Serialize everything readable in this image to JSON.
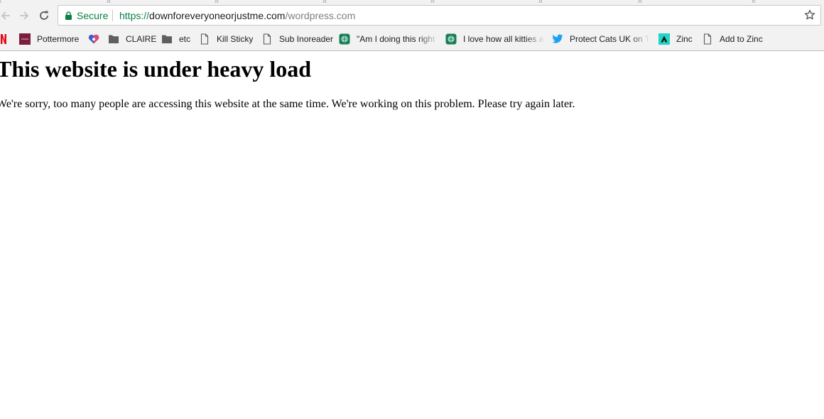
{
  "browser": {
    "security_label": "Secure",
    "url_scheme": "https://",
    "url_host": "downforeveryoneorjustme.com",
    "url_path": "/wordpress.com",
    "icons": [
      "back-arrow-icon",
      "forward-arrow-icon",
      "reload-icon",
      "lock-icon",
      "star-icon"
    ]
  },
  "bookmarks": [
    {
      "label": "",
      "icon": "netflix-icon"
    },
    {
      "label": "Pottermore",
      "icon": "pottermore-icon"
    },
    {
      "label": "",
      "icon": "heart-app-icon"
    },
    {
      "label": "CLAIRE",
      "icon": "folder-icon"
    },
    {
      "label": "etc",
      "icon": "folder-icon"
    },
    {
      "label": "Kill Sticky",
      "icon": "page-icon"
    },
    {
      "label": "Sub Inoreader",
      "icon": "page-icon"
    },
    {
      "label": "\"Am I doing this right",
      "icon": "globe-chat-icon"
    },
    {
      "label": "I love how all kitties a",
      "icon": "globe-chat-icon"
    },
    {
      "label": "Protect Cats UK on T",
      "icon": "twitter-icon"
    },
    {
      "label": "Zinc",
      "icon": "zinc-icon"
    },
    {
      "label": "Add to Zinc",
      "icon": "page-icon"
    }
  ],
  "page": {
    "heading": "This website is under heavy load",
    "message": "We're sorry, too many people are accessing this website at the same time. We're working on this problem. Please try again later."
  },
  "colors": {
    "secure_green": "#0b8043",
    "netflix_red": "#e50914",
    "pottermore_maroon": "#7a1e3c",
    "twitter_blue": "#1da1f2",
    "zinc_teal": "#21d4c4"
  }
}
